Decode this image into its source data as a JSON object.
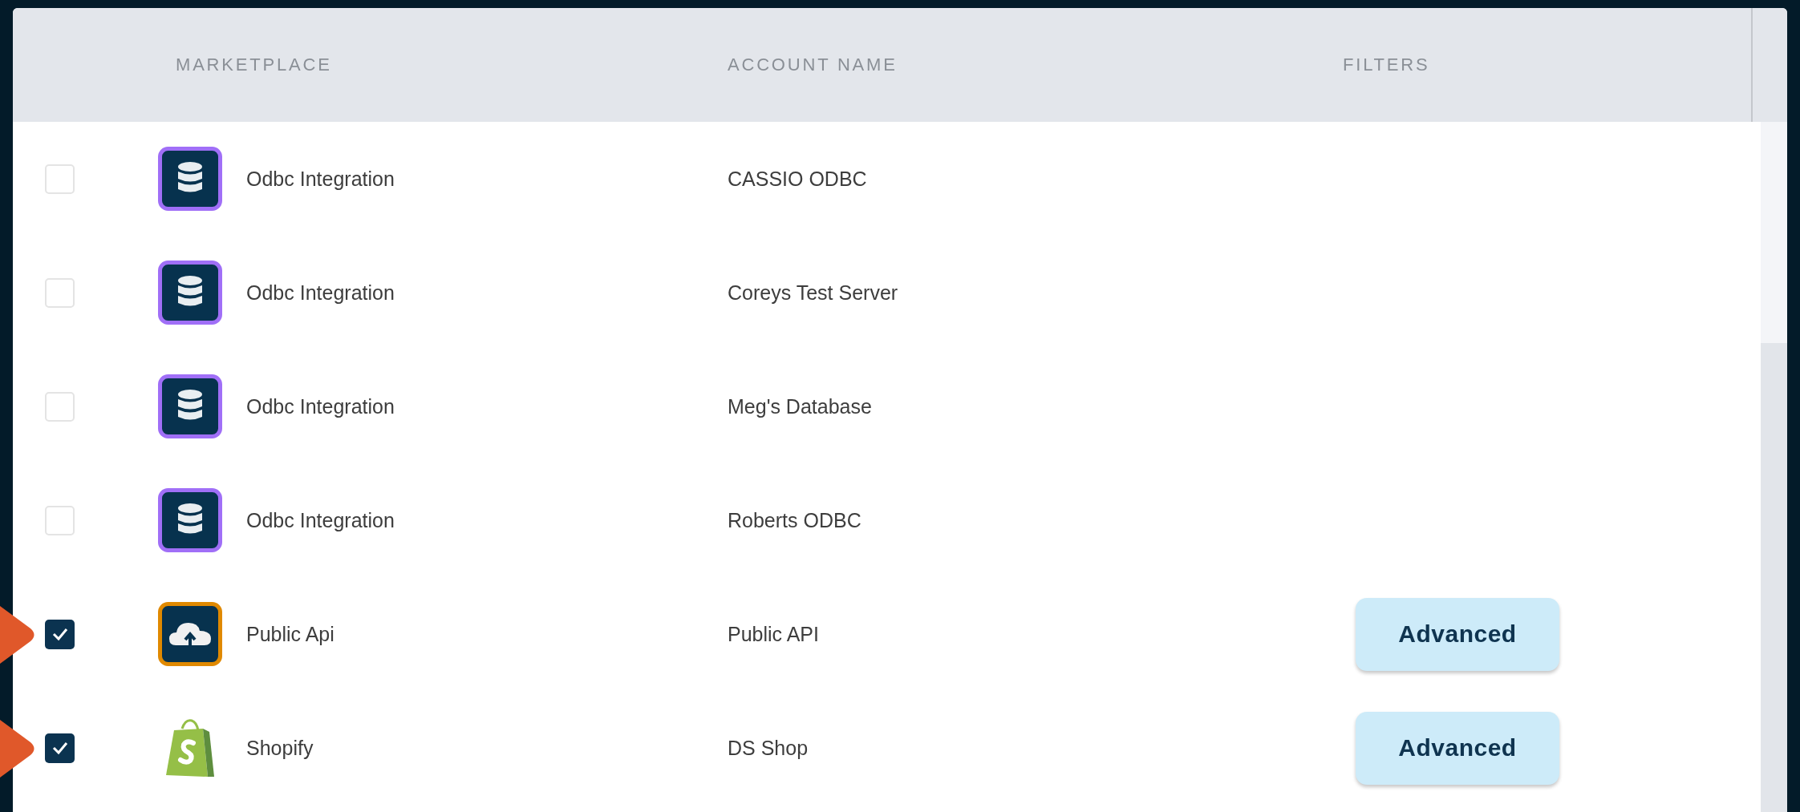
{
  "table": {
    "columns": [
      "MARKETPLACE",
      "ACCOUNT NAME",
      "FILTERS"
    ],
    "rows": [
      {
        "checked": false,
        "annotated": false,
        "kind": "database",
        "marketplace": "Odbc Integration",
        "account_name": "CASSIO ODBC"
      },
      {
        "checked": false,
        "annotated": false,
        "kind": "database",
        "marketplace": "Odbc Integration",
        "account_name": "Coreys Test Server"
      },
      {
        "checked": false,
        "annotated": false,
        "kind": "database",
        "marketplace": "Odbc Integration",
        "account_name": "Meg's Database"
      },
      {
        "checked": false,
        "annotated": false,
        "kind": "database",
        "marketplace": "Odbc Integration",
        "account_name": "Roberts ODBC"
      },
      {
        "checked": true,
        "annotated": true,
        "kind": "cloud",
        "marketplace": "Public Api",
        "account_name": "Public API",
        "filter": "Advanced"
      },
      {
        "checked": true,
        "annotated": true,
        "kind": "shopify",
        "marketplace": "Shopify",
        "account_name": "DS Shop",
        "filter": "Advanced"
      }
    ]
  }
}
